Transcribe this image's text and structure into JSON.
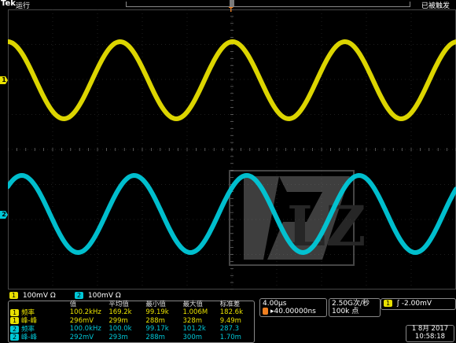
{
  "header": {
    "brand": "Tek",
    "run_state": "运行",
    "trigger_status": "已被触发",
    "trigger_position_marker": "T"
  },
  "channels": {
    "ch1_marker": "1",
    "ch2_marker": "2",
    "ch1_color": "#e8e000",
    "ch2_color": "#00c8d8"
  },
  "scales": {
    "ch1_label": "1",
    "ch1_value": "100mV Ω",
    "ch2_label": "2",
    "ch2_value": "100mV Ω"
  },
  "measurements": {
    "headers": [
      "值",
      "平均值",
      "最小值",
      "最大值",
      "标准差"
    ],
    "rows": [
      {
        "ch": "1",
        "name": "频率",
        "values": [
          "100.2kHz",
          "169.2k",
          "99.19k",
          "1.006M",
          "182.6k"
        ]
      },
      {
        "ch": "1",
        "name": "峰-峰",
        "values": [
          "296mV",
          "299m",
          "288m",
          "328m",
          "9.49m"
        ]
      },
      {
        "ch": "2",
        "name": "频率",
        "values": [
          "100.0kHz",
          "100.0k",
          "99.17k",
          "101.2k",
          "287.3"
        ]
      },
      {
        "ch": "2",
        "name": "峰-峰",
        "values": [
          "292mV",
          "293m",
          "288m",
          "300m",
          "1.70m"
        ]
      }
    ]
  },
  "horizontal": {
    "scale": "4.00μs",
    "delay": "▸40.00000ns"
  },
  "acquisition": {
    "rate": "2.50G次/秒",
    "length": "100k 点"
  },
  "trigger": {
    "source": "1",
    "slope": "ʃ",
    "level": "-2.00mV"
  },
  "datetime": {
    "date": "1 8月 2017",
    "time": "10:58:18"
  },
  "watermark": {
    "text": "LZ"
  }
}
